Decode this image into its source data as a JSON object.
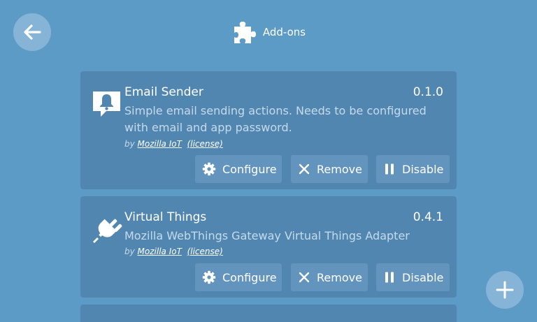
{
  "header": {
    "title": "Add-ons",
    "back_icon": "arrow-left-icon",
    "section_icon": "puzzle-piece-icon"
  },
  "addons": [
    {
      "name": "Email Sender",
      "version": "0.1.0",
      "description": "Simple email sending actions. Needs to be configured with email and app password.",
      "by_prefix": "by",
      "author": "Mozilla IoT",
      "license_label": "(license)",
      "icon": "notification-bell-icon",
      "buttons": {
        "configure": "Configure",
        "remove": "Remove",
        "disable": "Disable"
      }
    },
    {
      "name": "Virtual Things",
      "version": "0.4.1",
      "description": "Mozilla WebThings Gateway Virtual Things Adapter",
      "by_prefix": "by",
      "author": "Mozilla IoT",
      "license_label": "(license)",
      "icon": "plug-icon",
      "buttons": {
        "configure": "Configure",
        "remove": "Remove",
        "disable": "Disable"
      }
    }
  ],
  "fab": {
    "icon": "plus-icon"
  },
  "colors": {
    "background": "#5d9bc7",
    "card": "#5186b1",
    "button": "#6294bd",
    "round_button": "#86b4d7",
    "muted_text": "#c5dbec"
  }
}
